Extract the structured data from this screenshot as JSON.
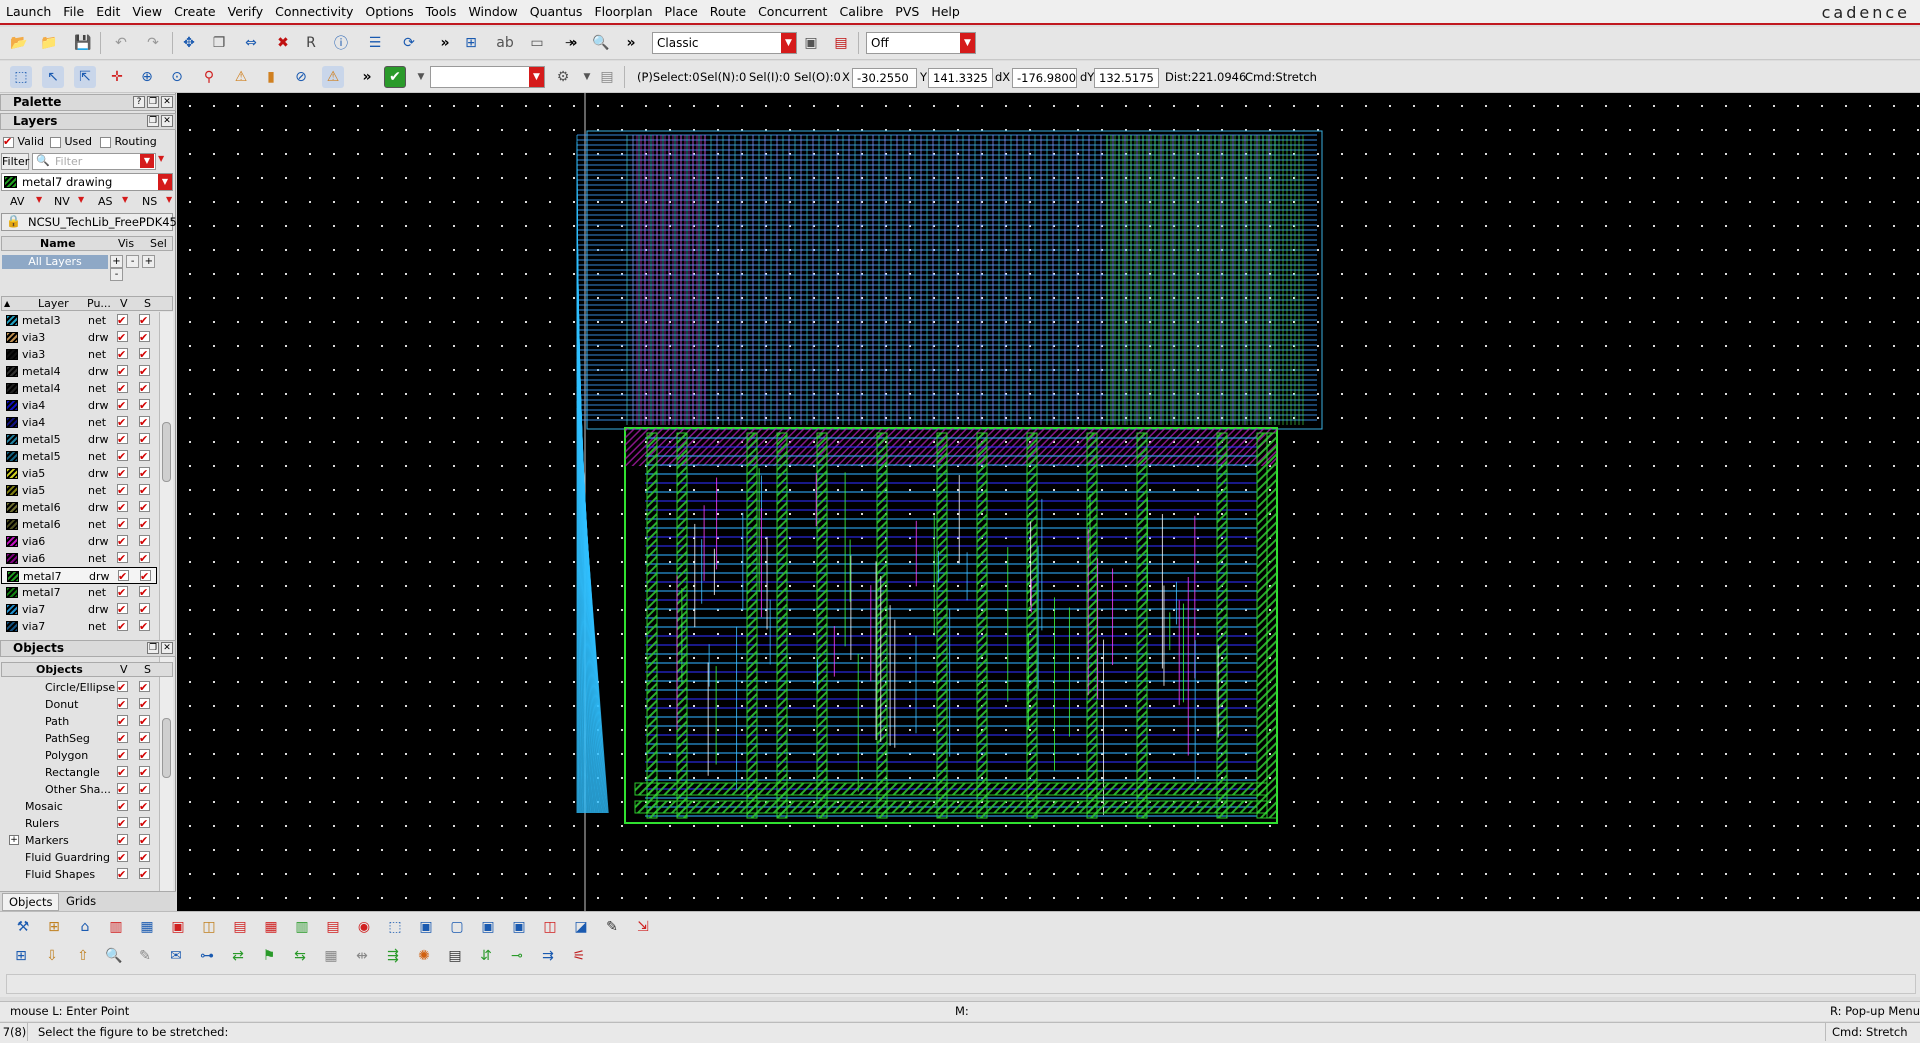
{
  "brand": "cadence",
  "menu": [
    "Launch",
    "File",
    "Edit",
    "View",
    "Create",
    "Verify",
    "Connectivity",
    "Options",
    "Tools",
    "Window",
    "Quantus",
    "Floorplan",
    "Place",
    "Route",
    "Concurrent",
    "Calibre",
    "PVS",
    "Help"
  ],
  "toolbar": {
    "workspace": "Classic",
    "mode": "Off",
    "more1": "»",
    "more2": "»",
    "more3": "»",
    "more4": "»"
  },
  "infobar": {
    "pselect": "(P)Select:0",
    "seln": "Sel(N):0",
    "seli": "Sel(I):0",
    "selo": "Sel(O):0",
    "x_label": "X",
    "x_value": "-30.2550",
    "y_label": "Y",
    "y_value": "141.3325",
    "dx_label": "dX",
    "dx_value": "-176.9800",
    "dy_label": "dY",
    "dy_value": "132.5175",
    "dist": "Dist:221.0946",
    "cmd": "Cmd:Stretch"
  },
  "palette": {
    "title": "Palette",
    "layers_title": "Layers",
    "valid": "Valid",
    "used": "Used",
    "routing": "Routing",
    "filter_btn": "Filter",
    "filter_placeholder": "Filter",
    "current_layer": "metal7 drawing",
    "av": "AV",
    "nv": "NV",
    "as": "AS",
    "ns": "NS",
    "techlib": "NCSU_TechLib_FreePDK45",
    "sets_header": {
      "name": "Name",
      "vis": "Vis",
      "sel": "Sel"
    },
    "all_layers": "All Layers",
    "layer_header": {
      "layer": "Layer",
      "purpose": "Pu...",
      "v": "V",
      "s": "S"
    },
    "layers": [
      {
        "name": "metal3",
        "purpose": "net",
        "color": "#20a0c0"
      },
      {
        "name": "via3",
        "purpose": "drw",
        "color": "#c09050"
      },
      {
        "name": "via3",
        "purpose": "net",
        "color": "#101010"
      },
      {
        "name": "metal4",
        "purpose": "drw",
        "color": "#303030"
      },
      {
        "name": "metal4",
        "purpose": "net",
        "color": "#202020"
      },
      {
        "name": "via4",
        "purpose": "drw",
        "color": "#1010c0"
      },
      {
        "name": "via4",
        "purpose": "net",
        "color": "#101080"
      },
      {
        "name": "metal5",
        "purpose": "drw",
        "color": "#2080a0"
      },
      {
        "name": "metal5",
        "purpose": "net",
        "color": "#106080"
      },
      {
        "name": "via5",
        "purpose": "drw",
        "color": "#d0d020"
      },
      {
        "name": "via5",
        "purpose": "net",
        "color": "#808010"
      },
      {
        "name": "metal6",
        "purpose": "drw",
        "color": "#707030"
      },
      {
        "name": "metal6",
        "purpose": "net",
        "color": "#505020"
      },
      {
        "name": "via6",
        "purpose": "drw",
        "color": "#c010c0"
      },
      {
        "name": "via6",
        "purpose": "net",
        "color": "#800080"
      },
      {
        "name": "metal7",
        "purpose": "drw",
        "color": "#20a020"
      },
      {
        "name": "metal7",
        "purpose": "net",
        "color": "#108010"
      },
      {
        "name": "via7",
        "purpose": "drw",
        "color": "#2090d0"
      },
      {
        "name": "via7",
        "purpose": "net",
        "color": "#105080"
      }
    ],
    "objects_title": "Objects",
    "objects_header": {
      "name": "Objects",
      "v": "V",
      "s": "S"
    },
    "objects": [
      {
        "name": "Circle/Ellipse",
        "indent": 2
      },
      {
        "name": "Donut",
        "indent": 2
      },
      {
        "name": "Path",
        "indent": 2
      },
      {
        "name": "PathSeg",
        "indent": 2
      },
      {
        "name": "Polygon",
        "indent": 2
      },
      {
        "name": "Rectangle",
        "indent": 2
      },
      {
        "name": "Other Sha...",
        "indent": 2
      },
      {
        "name": "Mosaic",
        "indent": 1
      },
      {
        "name": "Rulers",
        "indent": 1
      },
      {
        "name": "Markers",
        "indent": 1
      },
      {
        "name": "Fluid Guardring",
        "indent": 1
      },
      {
        "name": "Fluid Shapes",
        "indent": 1
      }
    ],
    "tabs": [
      "Objects",
      "Grids"
    ]
  },
  "status": {
    "mouse_l": "mouse L: Enter Point",
    "mouse_m": "M:",
    "mouse_r": "R: Pop-up Menu",
    "count": "7(8)",
    "prompt": "Select the figure to be stretched:",
    "cmd": "Cmd: Stretch"
  }
}
